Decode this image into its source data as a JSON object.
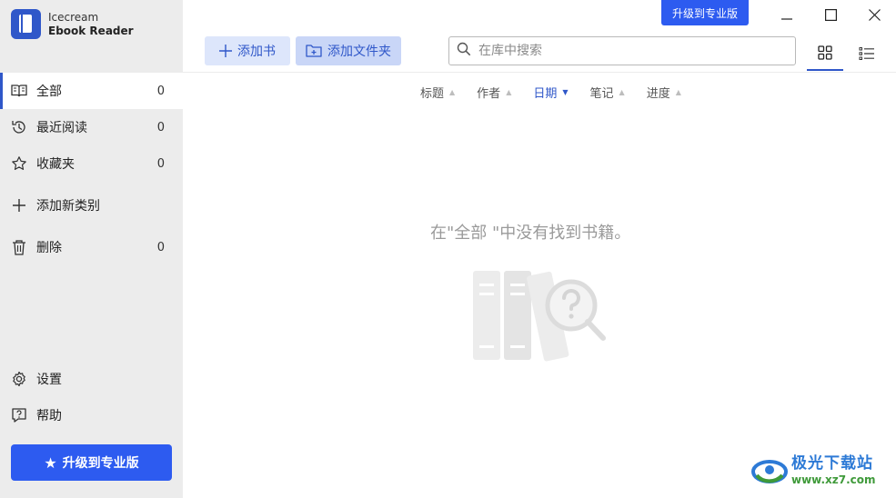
{
  "app": {
    "name_line1": "Icecream",
    "name_line2": "Ebook Reader"
  },
  "topbar": {
    "upgrade_label": "升级到专业版",
    "add_book_label": "添加书",
    "add_folder_label": "添加文件夹",
    "search_placeholder": "在库中搜索"
  },
  "sidebar": {
    "items": [
      {
        "label": "全部",
        "count": "0"
      },
      {
        "label": "最近阅读",
        "count": "0"
      },
      {
        "label": "收藏夹",
        "count": "0"
      },
      {
        "label": "添加新类别"
      },
      {
        "label": "删除",
        "count": "0"
      }
    ],
    "settings_label": "设置",
    "help_label": "帮助",
    "upgrade_label": "升级到专业版"
  },
  "sort": {
    "columns": [
      {
        "label": "标题"
      },
      {
        "label": "作者"
      },
      {
        "label": "日期"
      },
      {
        "label": "笔记"
      },
      {
        "label": "进度"
      }
    ]
  },
  "main": {
    "empty_message": "在\"全部 \"中没有找到书籍。"
  },
  "watermark": {
    "line1": "极光下载站",
    "line2": "www.xz7.com"
  },
  "colors": {
    "accent": "#2d5bf0",
    "sidebar_bg": "#ececec"
  }
}
